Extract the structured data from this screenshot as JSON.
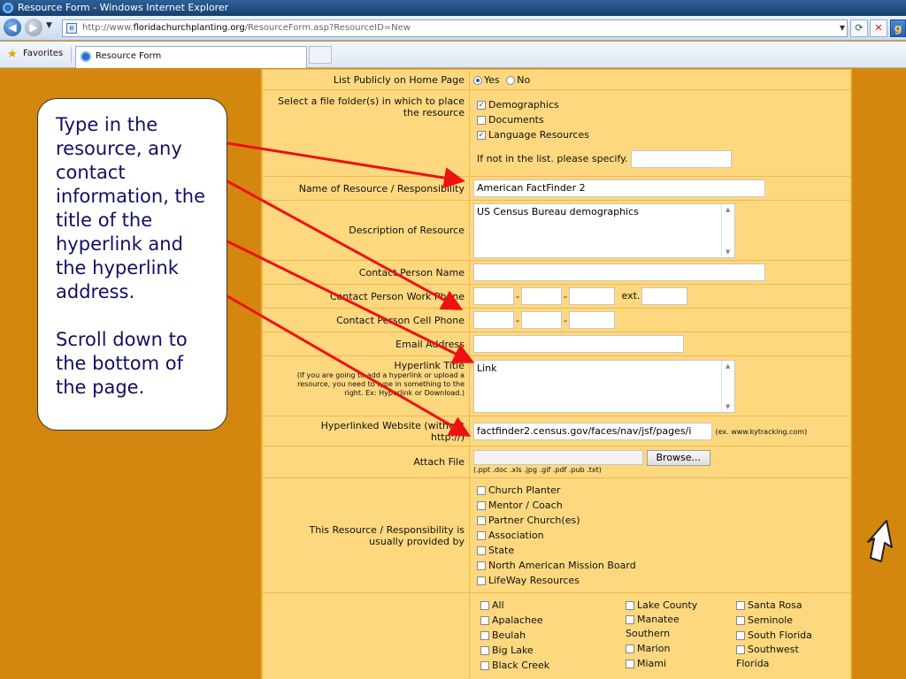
{
  "window": {
    "title": "Resource Form - Windows Internet Explorer"
  },
  "address": {
    "scheme": "http://www.",
    "host": "floridachurchplanting.org",
    "path": "/ResourceForm.asp?ResourceID=New"
  },
  "favorites": {
    "label": "Favorites"
  },
  "tab": {
    "title": "Resource Form"
  },
  "form": {
    "list_publicly": {
      "label": "List Publicly on Home Page",
      "yes": "Yes",
      "no": "No",
      "selected": "Yes"
    },
    "folders": {
      "label": "Select a file folder(s) in which to place the resource",
      "options": [
        {
          "label": "Demographics",
          "checked": true
        },
        {
          "label": "Documents",
          "checked": false
        },
        {
          "label": "Language Resources",
          "checked": true
        }
      ],
      "other_label": "If not in the list. please specify.",
      "other_value": ""
    },
    "name": {
      "label": "Name of Resource / Responsibility",
      "value": "American FactFinder 2"
    },
    "description": {
      "label": "Description of Resource",
      "value": "US Census Bureau demographics"
    },
    "contact_name": {
      "label": "Contact Person Name",
      "value": ""
    },
    "work_phone": {
      "label": "Contact Person Work Phone",
      "ext_label": "ext."
    },
    "cell_phone": {
      "label": "Contact Person Cell Phone"
    },
    "email": {
      "label": "Email Address",
      "value": ""
    },
    "hyperlink_title": {
      "label": "Hyperlink Title",
      "note": "(If you are going to add a hyperlink or upload a resource, you need to type in something to the right.  Ex: Hyperlink or Download.)",
      "value": "Link"
    },
    "website": {
      "label": "Hyperlinked Website (without http://)",
      "value": "factfinder2.census.gov/faces/nav/jsf/pages/i",
      "example": "(ex. www.kytracking.com)"
    },
    "attach": {
      "label": "Attach File",
      "browse": "Browse...",
      "types": "(.ppt .doc .xls .jpg .gif  .pdf .pub  .txt)"
    },
    "provided_by": {
      "label": "This Resource / Responsibility is usually provided by",
      "options": [
        "Church Planter",
        "Mentor / Coach",
        "Partner Church(es)",
        "Association",
        "State",
        "North American Mission Board",
        "LifeWay Resources"
      ]
    },
    "regions": {
      "col1": [
        "All",
        "Apalachee",
        "Beulah",
        "Big Lake",
        "Black Creek"
      ],
      "col2": [
        "Lake County",
        "Manatee Southern",
        "Marion",
        "Miami"
      ],
      "col3": [
        "Santa Rosa",
        "Seminole",
        "South Florida",
        "Southwest Florida"
      ]
    }
  },
  "callout": {
    "line1": "Type in the resource, any contact information, the title of the hyperlink and the hyperlink address.",
    "line2": "Scroll down to the bottom of the page."
  },
  "colors": {
    "page_bg": "#d4870f",
    "row_bg": "#fdd87f",
    "arrow": "#ee1111",
    "callout_text": "#101064"
  }
}
